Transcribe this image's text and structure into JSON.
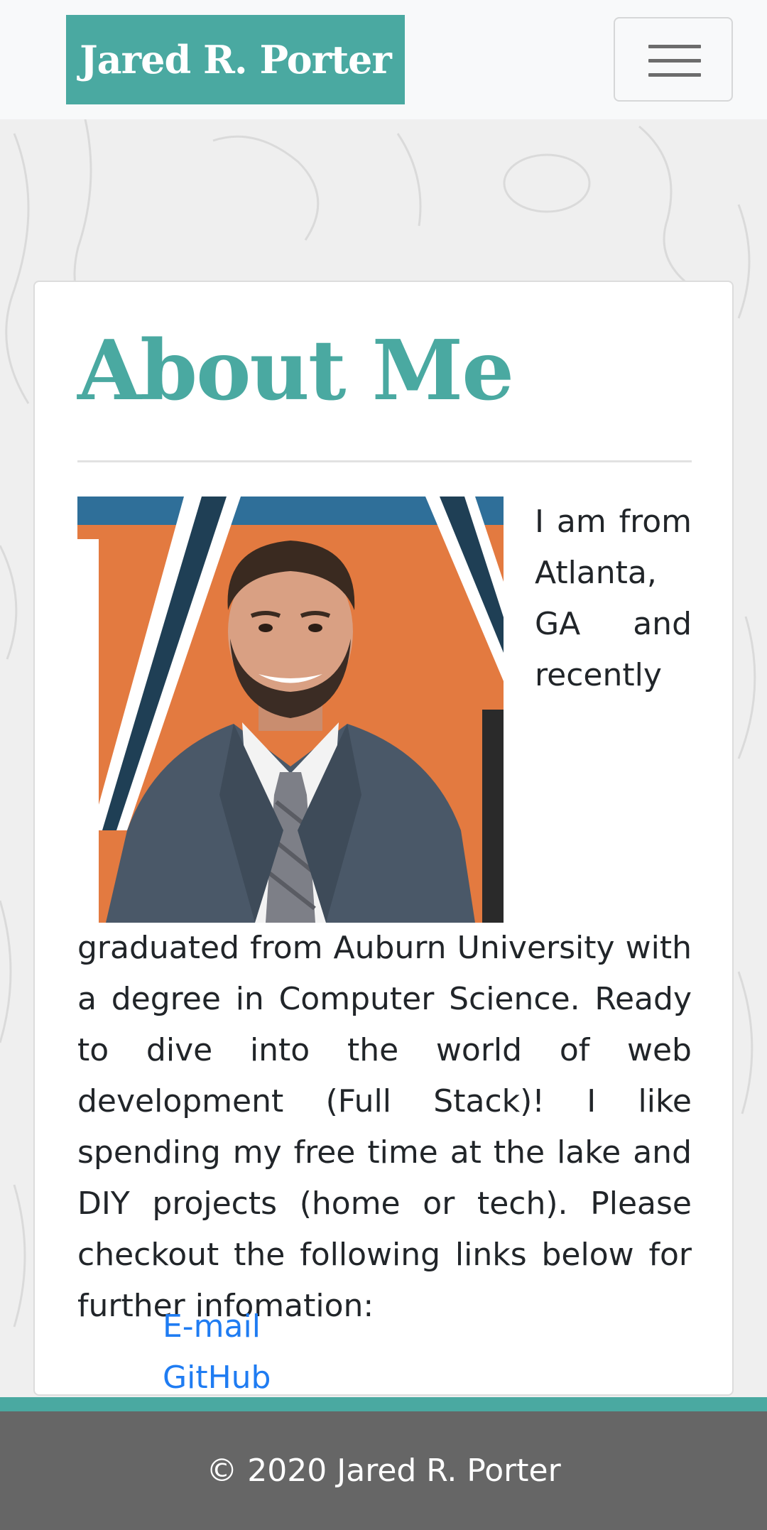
{
  "navbar": {
    "brand": "Jared R. Porter",
    "toggler_icon": "hamburger-menu-icon"
  },
  "about": {
    "title": "About Me",
    "photo_alt": "Headshot of Jared R. Porter",
    "text": "I am from Atlanta, GA and recently graduated from Auburn University with a degree in Computer Science. Ready to dive into the world of web development (Full Stack)! I like spending my free time at the lake and DIY projects (home or tech). Please checkout the following links below for further infomation:"
  },
  "links": [
    {
      "label": "E-mail"
    },
    {
      "label": "GitHub"
    }
  ],
  "footer": {
    "text": "© 2020 Jared R. Porter"
  },
  "colors": {
    "accent": "#4aa9a1",
    "link": "#1f7cf2",
    "footer_bg": "#666666"
  }
}
